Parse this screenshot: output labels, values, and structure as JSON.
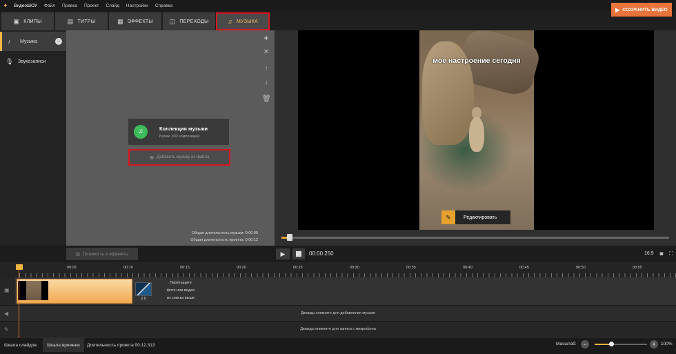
{
  "menubar": {
    "app": "ВидеоШОУ",
    "items": [
      "Файл",
      "Правка",
      "Проект",
      "Слайд",
      "Настройки",
      "Справка"
    ]
  },
  "tabs": [
    {
      "label": "КЛИПЫ",
      "icon": "clips-icon"
    },
    {
      "label": "ТИТРЫ",
      "icon": "titles-icon"
    },
    {
      "label": "ЭФФЕКТЫ",
      "icon": "effects-icon"
    },
    {
      "label": "ПЕРЕХОДЫ",
      "icon": "transitions-icon"
    },
    {
      "label": "МУЗЫКА",
      "icon": "music-note-icon",
      "active": true
    }
  ],
  "save_button": "СОХРАНИТЬ ВИДЕО",
  "sidebar": {
    "items": [
      {
        "label": "Музыка",
        "active": true
      },
      {
        "label": "Звукозаписи"
      }
    ]
  },
  "panel": {
    "collection_title": "Коллекция музыки",
    "collection_subtitle": "Более 200 композиций",
    "add_from_file": "Добавить музыку из файла",
    "music_duration": "Общая длительность музыки: 0:00:00",
    "project_duration": "Общая длительность проекта: 0:00:12"
  },
  "preview": {
    "overlay_text": "мое настроение сегодня",
    "edit_button": "Редактировать",
    "seek_fraction": 0.02
  },
  "controls": {
    "volume_effects": "Громкость и эффекты",
    "time": "00:00.250",
    "aspect": "16:9"
  },
  "timeline": {
    "ticks": [
      "00:05",
      "00:10",
      "00:15",
      "00:20",
      "00:25",
      "00:30",
      "00:35",
      "00:40",
      "00:45",
      "00:50",
      "00:55"
    ],
    "transition_duration": "2.0",
    "drop_hint": [
      "Перетащите",
      "фото или видео",
      "из списка выше"
    ],
    "music_hint": "Дважды кликните для добавления музыки",
    "voice_hint": "Дважды кликните для записи с микрофона"
  },
  "status": {
    "slides_tab": "Шкала слайдов",
    "timeline_tab": "Шкала времени",
    "project_duration": "Длительность проекта 00:12.313",
    "scale_label": "Масштаб:",
    "zoom": "100%"
  },
  "colors": {
    "accent": "#f2b640",
    "save": "#e8743b",
    "highlight": "#d9161f",
    "music_green": "#3ebc5c"
  }
}
